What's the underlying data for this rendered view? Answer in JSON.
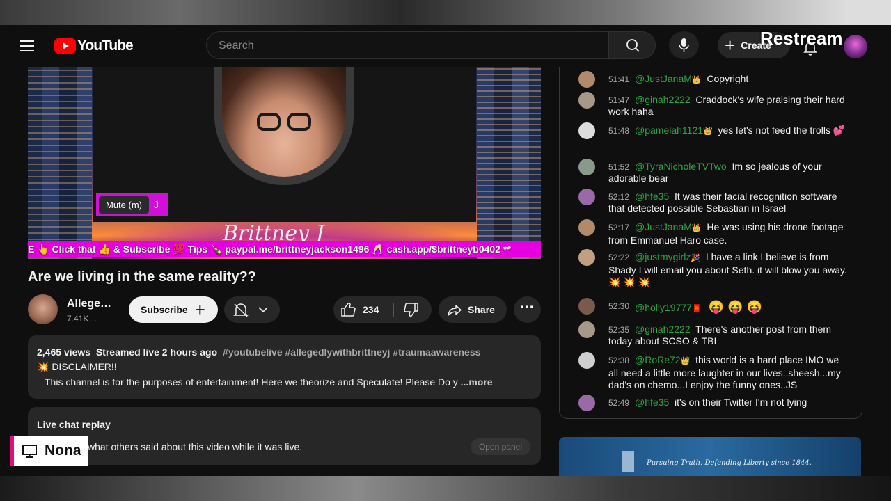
{
  "header": {
    "logo_text": "YouTube",
    "search_placeholder": "Search",
    "create_label": "Create",
    "overlay_brand": "Restream"
  },
  "video": {
    "tooltip": "Mute (m)",
    "ticker_text": "E 👆 Click that 👍 & Subscribe 💯 Tips 🍾 paypal.me/brittneyjackson1496 🥂 cash.app/$brittneyb0402 **",
    "title": "Are we living in the same reality??"
  },
  "channel": {
    "name": "Allege…",
    "subscribers": "7.41K…",
    "subscribe_label": "Subscribe",
    "like_count": "234",
    "share_label": "Share"
  },
  "description": {
    "views": "2,465 views",
    "streamed": "Streamed live 2 hours ago",
    "tags": "#youtubelive #allegedlywithbrittneyj #traumaawareness",
    "disclaimer": "💥 DISCLAIMER!!",
    "body": "This channel is for the purposes of entertainment!  Here we theorize and Speculate!  Please Do y",
    "more_label": "...more"
  },
  "live_chat_replay": {
    "title": "Live chat replay",
    "text": "what others said about this video while it was live.",
    "open_label": "Open panel"
  },
  "lower_third": {
    "name": "Nona"
  },
  "chat": {
    "messages": [
      {
        "time": "51:41",
        "author": "@JustJanaM",
        "badge": "👑",
        "text": "Copyright",
        "avatar_color": "#b08a6a"
      },
      {
        "time": "51:47",
        "author": "@ginah2222",
        "badge": "",
        "text": "Craddock's wife praising their hard work haha",
        "avatar_color": "#a89888"
      },
      {
        "time": "51:48",
        "author": "@pamelah1121",
        "badge": "👑",
        "text": "yes let's not feed the trolls 💕",
        "avatar_color": "#dcdcdc"
      },
      {
        "time": "51:52",
        "author": "@TyraNicholeTVTwo",
        "badge": "",
        "text": "Im so jealous of your adorable bear",
        "avatar_color": "#8a9a8a"
      },
      {
        "time": "52:12",
        "author": "@hfe35",
        "badge": "",
        "text": "It was their facial recognition software that detected possible Sebastian in Israel",
        "avatar_color": "#9a6aa8"
      },
      {
        "time": "52:17",
        "author": "@JustJanaM",
        "badge": "👑",
        "text": "He was using his drone footage from Emmanuel Haro case.",
        "avatar_color": "#b08a6a"
      },
      {
        "time": "52:22",
        "author": "@justmygirlz",
        "badge": "🎉",
        "text": "I have a link I believe is from Shady I will email you about Seth. it will blow you away. 💥 💥 💥",
        "avatar_color": "#c0a080"
      },
      {
        "time": "52:30",
        "author": "@holly19777",
        "badge": "🧧",
        "text": "😝 😝 😝",
        "avatar_color": "#7a5a4a"
      },
      {
        "time": "52:35",
        "author": "@ginah2222",
        "badge": "",
        "text": "There's another post from them today about SCSO & TBI",
        "avatar_color": "#a89888"
      },
      {
        "time": "52:38",
        "author": "@RoRe72",
        "badge": "👑",
        "text": "this world is a hard place IMO we all need a little more laughter in our lives..sheesh...my dad's on chemo...I enjoy the funny ones..JS",
        "avatar_color": "#cfcfcf"
      },
      {
        "time": "52:49",
        "author": "@hfe35",
        "badge": "",
        "text": "it's on their Twitter I'm not lying",
        "avatar_color": "#9a6aa8"
      }
    ]
  },
  "ad": {
    "tagline": "Pursuing Truth. Defending Liberty since 1844."
  },
  "colors": {
    "brand_red": "#ff0000",
    "chat_author": "#2ba640",
    "ticker": "#e600e0",
    "lower_third_accent": "#e0107a"
  }
}
